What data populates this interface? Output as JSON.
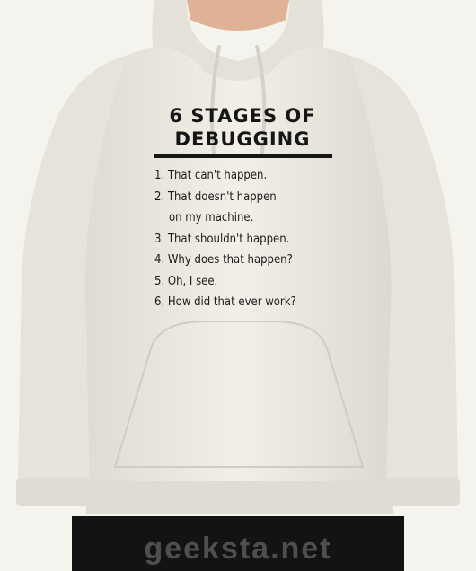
{
  "print": {
    "title_line1": "6 STAGES OF",
    "title_line2": "DEBUGGING",
    "stages": [
      {
        "text": "1. That can't happen."
      },
      {
        "text": "2. That doesn't happen",
        "cont": "on my machine."
      },
      {
        "text": "3. That shouldn't happen."
      },
      {
        "text": "4. Why does that happen?"
      },
      {
        "text": "5. Oh, I see."
      },
      {
        "text": "6. How did that ever work?"
      }
    ]
  },
  "watermark": "geeksta.net",
  "colors": {
    "background": "#f4f3ee",
    "hoodie": "#efede4",
    "ink": "#161616",
    "pants": "#131313"
  }
}
